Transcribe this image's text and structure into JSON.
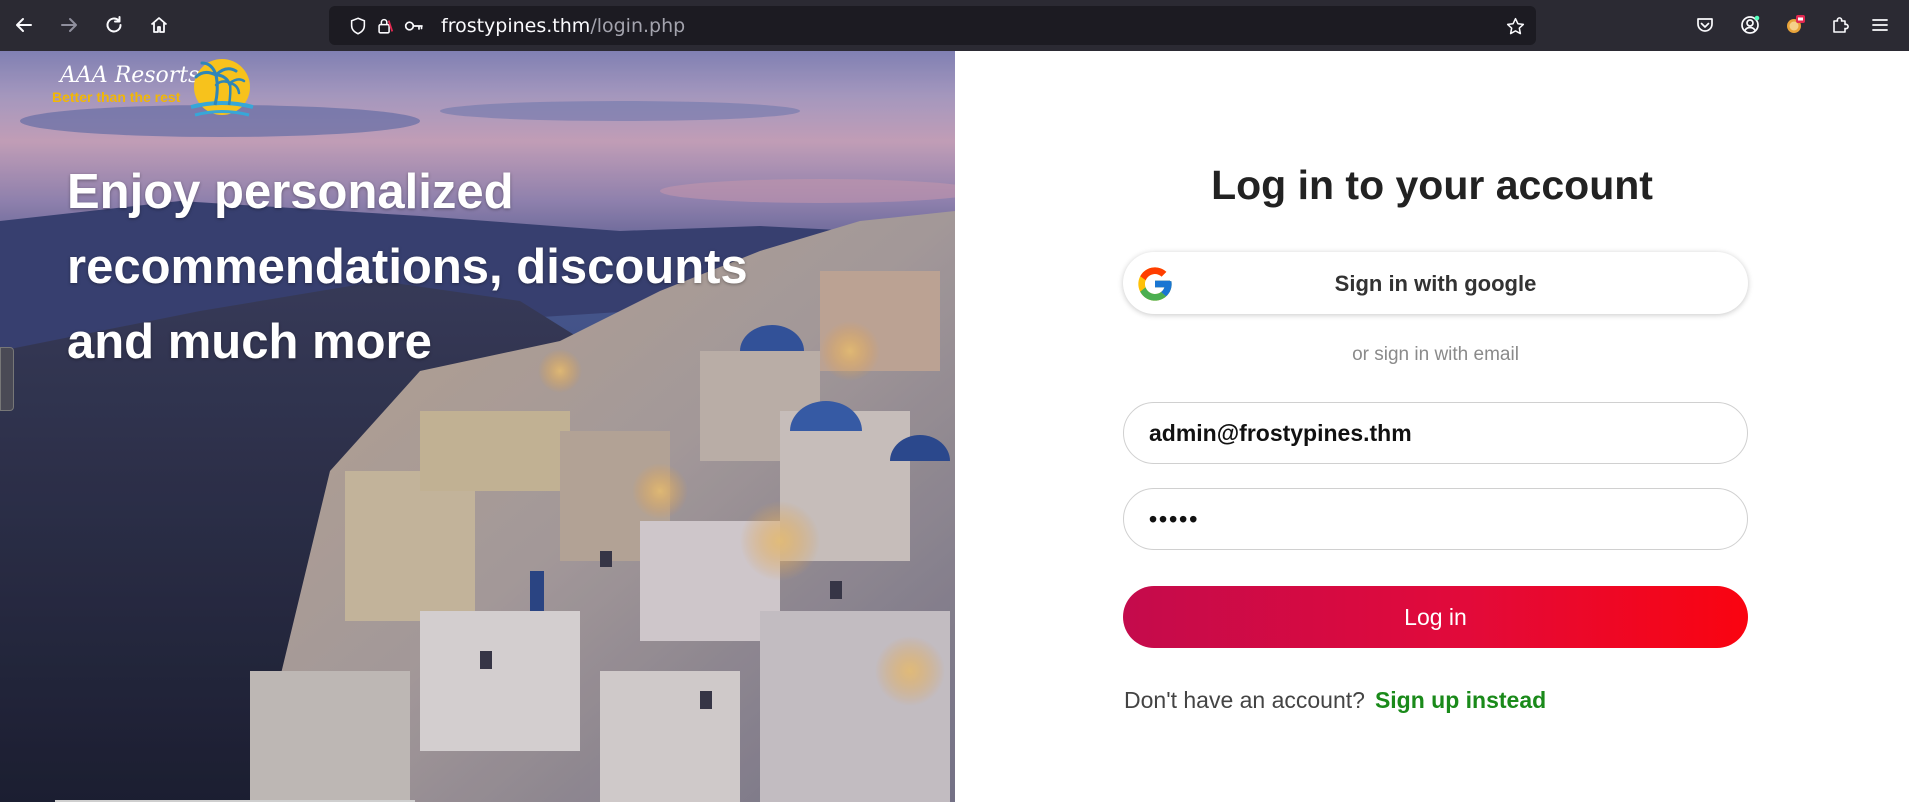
{
  "browser": {
    "url_host": "frostypines.thm",
    "url_path": "/login.php",
    "icons": {
      "back": "arrow-left-icon",
      "forward": "arrow-right-icon",
      "reload": "reload-icon",
      "home": "home-icon",
      "tracking": "shield-icon",
      "insecure": "lock-warning-icon",
      "permissions": "key-icon",
      "bookmark": "star-icon",
      "pocket": "pocket-icon",
      "account": "account-icon",
      "extension": "extension-icon",
      "puzzle": "puzzle-icon",
      "menu": "hamburger-menu-icon"
    }
  },
  "hero": {
    "logo_name": "AAA Resorts",
    "logo_tagline": "Better than the rest",
    "caption_line1": "Enjoy personalized",
    "caption_line2": "recommendations, discounts",
    "caption_line3": "and much more"
  },
  "login": {
    "title": "Log in to your account",
    "google_button": "Sign in with google",
    "divider": "or sign in with email",
    "email_value": "admin@frostypines.thm",
    "password_value": "•••••",
    "submit_label": "Log in",
    "signup_question": "Don't have an account?",
    "signup_link": "Sign up instead"
  },
  "colors": {
    "toolbar_bg": "#2b2a33",
    "urlbar_bg": "#1c1b22",
    "login_gradient_start": "#c40b4c",
    "login_gradient_end": "#fa0410",
    "signup_link": "#1a8a1a"
  }
}
